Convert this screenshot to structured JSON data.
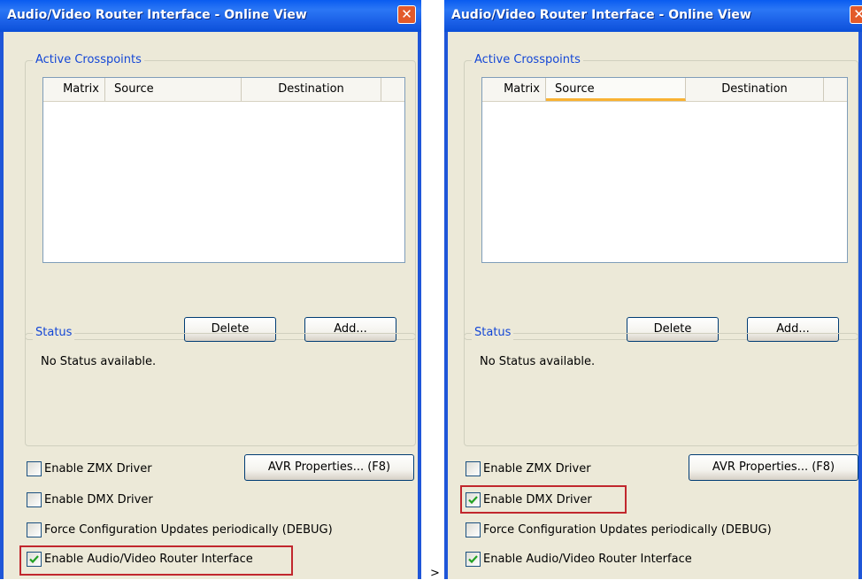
{
  "windows": [
    {
      "title": "Audio/Video Router Interface - Online View",
      "close_glyph": "✕",
      "group_crosspoints": "Active Crosspoints",
      "columns": [
        "Matrix",
        "Source",
        "Destination"
      ],
      "delete_label": "Delete",
      "add_label": "Add...",
      "group_status": "Status",
      "status_text": "No Status available.",
      "avr_properties_label": "AVR Properties... (F8)",
      "checkboxes": [
        {
          "label": "Enable ZMX Driver",
          "checked": false
        },
        {
          "label": "Enable DMX Driver",
          "checked": false
        },
        {
          "label": "Force Configuration Updates periodically (DEBUG)",
          "checked": false
        },
        {
          "label": "Enable Audio/Video Router Interface",
          "checked": true
        }
      ],
      "highlighted_checkbox": "Enable Audio/Video Router Interface"
    },
    {
      "title": "Audio/Video Router Interface - Online View",
      "close_glyph": "✕",
      "group_crosspoints": "Active Crosspoints",
      "columns": [
        "Matrix",
        "Source",
        "Destination"
      ],
      "hot_column": "Source",
      "delete_label": "Delete",
      "add_label": "Add...",
      "group_status": "Status",
      "status_text": "No Status available.",
      "avr_properties_label": "AVR Properties... (F8)",
      "checkboxes": [
        {
          "label": "Enable ZMX Driver",
          "checked": false
        },
        {
          "label": "Enable DMX Driver",
          "checked": true
        },
        {
          "label": "Force Configuration Updates periodically (DEBUG)",
          "checked": false
        },
        {
          "label": "Enable Audio/Video Router Interface",
          "checked": true
        }
      ],
      "highlighted_checkbox": "Enable DMX Driver"
    }
  ],
  "separator": ">",
  "icons": {
    "close": "close-icon",
    "check": "checkmark-icon"
  },
  "colors": {
    "title_blue": "#0a5cf0",
    "group_label": "#1447d6",
    "highlight": "#c1272d",
    "checkmark": "#21a121"
  }
}
